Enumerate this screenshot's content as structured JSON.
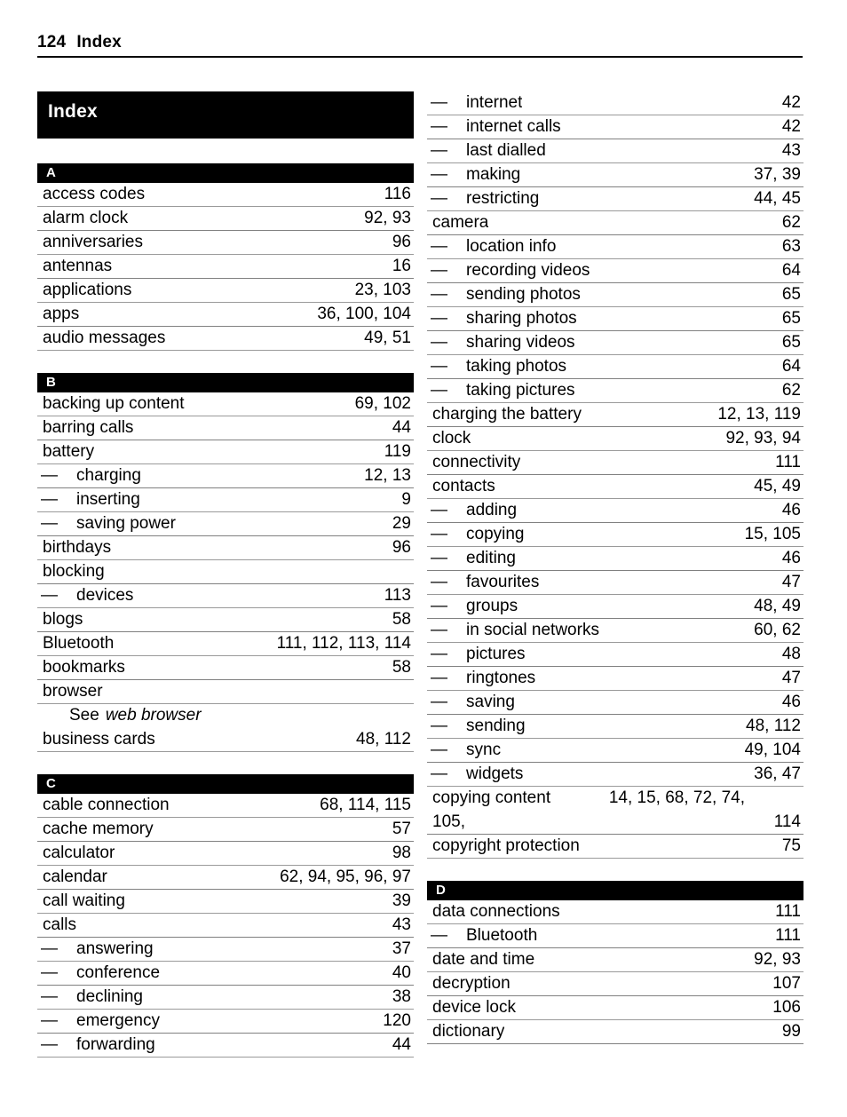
{
  "page_header": {
    "page_number": "124",
    "section_name": "Index"
  },
  "title_band": {
    "label": "Index"
  },
  "left_column": {
    "sections": [
      {
        "letter": "A",
        "entries": [
          {
            "term": "access codes",
            "pages": "116",
            "sub": false
          },
          {
            "term": "alarm clock",
            "pages": "92, 93",
            "sub": false
          },
          {
            "term": "anniversaries",
            "pages": "96",
            "sub": false
          },
          {
            "term": "antennas",
            "pages": "16",
            "sub": false
          },
          {
            "term": "applications",
            "pages": "23, 103",
            "sub": false
          },
          {
            "term": "apps",
            "pages": "36, 100, 104",
            "sub": false
          },
          {
            "term": "audio messages",
            "pages": "49, 51",
            "sub": false
          }
        ]
      },
      {
        "letter": "B",
        "entries": [
          {
            "term": "backing up content",
            "pages": "69, 102",
            "sub": false
          },
          {
            "term": "barring calls",
            "pages": "44",
            "sub": false
          },
          {
            "term": "battery",
            "pages": "119",
            "sub": false
          },
          {
            "term": "charging",
            "pages": "12, 13",
            "sub": true
          },
          {
            "term": "inserting",
            "pages": "9",
            "sub": true
          },
          {
            "term": "saving power",
            "pages": "29",
            "sub": true
          },
          {
            "term": "birthdays",
            "pages": "96",
            "sub": false
          },
          {
            "term": "blocking",
            "pages": "",
            "sub": false
          },
          {
            "term": "devices",
            "pages": "113",
            "sub": true
          },
          {
            "term": "blogs",
            "pages": "58",
            "sub": false
          },
          {
            "term": "Bluetooth",
            "pages": "111, 112, 113, 114",
            "sub": false
          },
          {
            "term": "bookmarks",
            "pages": "58",
            "sub": false
          },
          {
            "term": "browser",
            "pages": "",
            "sub": false
          },
          {
            "term": "See",
            "xref_target": "web browser",
            "xref": true
          },
          {
            "term": "business cards",
            "pages": "48, 112",
            "sub": false
          }
        ]
      },
      {
        "letter": "C",
        "entries": [
          {
            "term": "cable connection",
            "pages": "68, 114, 115",
            "sub": false
          },
          {
            "term": "cache memory",
            "pages": "57",
            "sub": false
          },
          {
            "term": "calculator",
            "pages": "98",
            "sub": false
          },
          {
            "term": "calendar",
            "pages": "62, 94, 95, 96, 97",
            "sub": false
          },
          {
            "term": "call waiting",
            "pages": "39",
            "sub": false
          },
          {
            "term": "calls",
            "pages": "43",
            "sub": false
          },
          {
            "term": "answering",
            "pages": "37",
            "sub": true
          },
          {
            "term": "conference",
            "pages": "40",
            "sub": true
          },
          {
            "term": "declining",
            "pages": "38",
            "sub": true
          },
          {
            "term": "emergency",
            "pages": "120",
            "sub": true
          },
          {
            "term": "forwarding",
            "pages": "44",
            "sub": true
          }
        ]
      }
    ]
  },
  "right_column": {
    "sections": [
      {
        "letter": "",
        "entries": [
          {
            "term": "internet",
            "pages": "42",
            "sub": true
          },
          {
            "term": "internet calls",
            "pages": "42",
            "sub": true
          },
          {
            "term": "last dialled",
            "pages": "43",
            "sub": true
          },
          {
            "term": "making",
            "pages": "37, 39",
            "sub": true
          },
          {
            "term": "restricting",
            "pages": "44, 45",
            "sub": true
          },
          {
            "term": "camera",
            "pages": "62",
            "sub": false
          },
          {
            "term": "location info",
            "pages": "63",
            "sub": true
          },
          {
            "term": "recording videos",
            "pages": "64",
            "sub": true
          },
          {
            "term": "sending photos",
            "pages": "65",
            "sub": true
          },
          {
            "term": "sharing photos",
            "pages": "65",
            "sub": true
          },
          {
            "term": "sharing videos",
            "pages": "65",
            "sub": true
          },
          {
            "term": "taking photos",
            "pages": "64",
            "sub": true
          },
          {
            "term": "taking pictures",
            "pages": "62",
            "sub": true
          },
          {
            "term": "charging the battery",
            "pages": "12, 13, 119",
            "sub": false
          },
          {
            "term": "clock",
            "pages": "92, 93, 94",
            "sub": false
          },
          {
            "term": "connectivity",
            "pages": "111",
            "sub": false
          },
          {
            "term": "contacts",
            "pages": "45, 49",
            "sub": false
          },
          {
            "term": "adding",
            "pages": "46",
            "sub": true
          },
          {
            "term": "copying",
            "pages": "15, 105",
            "sub": true
          },
          {
            "term": "editing",
            "pages": "46",
            "sub": true
          },
          {
            "term": "favourites",
            "pages": "47",
            "sub": true
          },
          {
            "term": "groups",
            "pages": "48, 49",
            "sub": true
          },
          {
            "term": "in social networks",
            "pages": "60, 62",
            "sub": true
          },
          {
            "term": "pictures",
            "pages": "48",
            "sub": true
          },
          {
            "term": "ringtones",
            "pages": "47",
            "sub": true
          },
          {
            "term": "saving",
            "pages": "46",
            "sub": true
          },
          {
            "term": "sending",
            "pages": "48, 112",
            "sub": true
          },
          {
            "term": "sync",
            "pages": "49, 104",
            "sub": true
          },
          {
            "term": "widgets",
            "pages": "36, 47",
            "sub": true
          },
          {
            "term": "copying content",
            "pages_line1": "14, 15, 68, 72, 74,",
            "term_line2": "105,",
            "pages_line2": "114",
            "wrap": true
          },
          {
            "term": "copyright protection",
            "pages": "75",
            "sub": false
          }
        ]
      },
      {
        "letter": "D",
        "entries": [
          {
            "term": "data connections",
            "pages": "111",
            "sub": false
          },
          {
            "term": "Bluetooth",
            "pages": "111",
            "sub": true
          },
          {
            "term": "date and time",
            "pages": "92, 93",
            "sub": false
          },
          {
            "term": "decryption",
            "pages": "107",
            "sub": false
          },
          {
            "term": "device lock",
            "pages": "106",
            "sub": false
          },
          {
            "term": "dictionary",
            "pages": "99",
            "sub": false
          }
        ]
      }
    ]
  },
  "glyphs": {
    "em_dash": "—"
  },
  "colors": {
    "band_background": "#000000",
    "band_text": "#ffffff",
    "rule": "#9a9a9a",
    "text": "#000000",
    "page_background": "#ffffff"
  }
}
